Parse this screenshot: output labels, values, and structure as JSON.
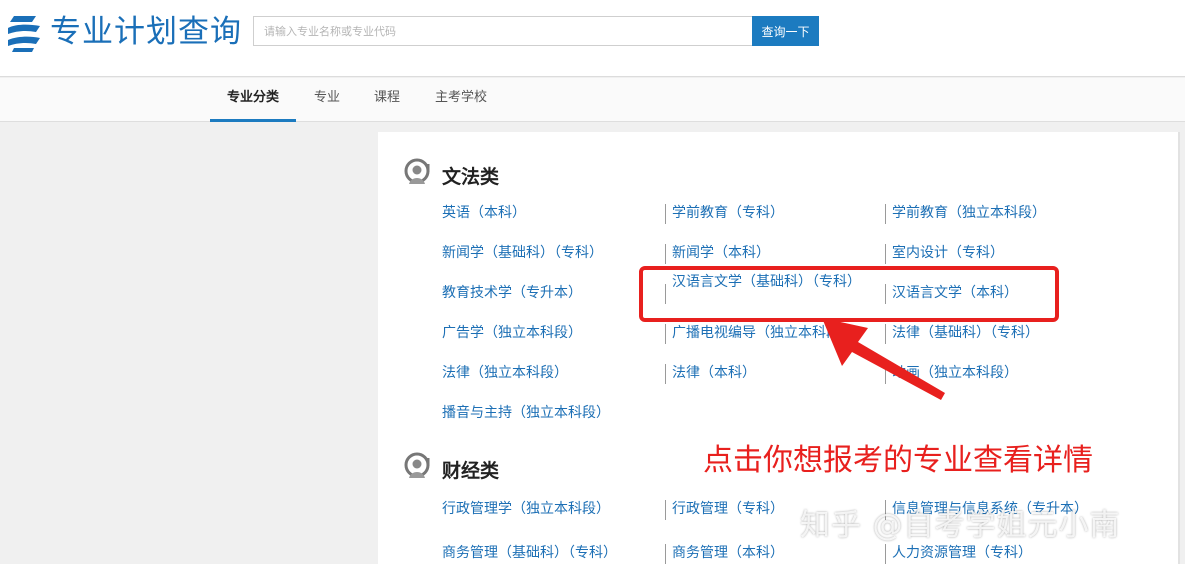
{
  "header": {
    "site_title": "专业计划查询",
    "search_placeholder": "请输入专业名称或专业代码",
    "search_button": "查询一下"
  },
  "nav": {
    "tabs": [
      "专业分类",
      "专业",
      "课程",
      "主考学校"
    ],
    "active": "专业分类"
  },
  "categories": [
    {
      "title": "文法类",
      "icon": "at-sign-person-icon",
      "rows": [
        [
          "英语（本科）",
          "学前教育（专科）",
          "学前教育（独立本科段）"
        ],
        [
          "新闻学（基础科）（专科）",
          "新闻学（本科）",
          "室内设计（专科）"
        ],
        [
          "教育技术学（专升本）",
          "汉语言文学（基础科）（专科）",
          "汉语言文学（本科）"
        ],
        [
          "广告学（独立本科段）",
          "广播电视编导（独立本科段）",
          "法律（基础科）（专科）"
        ],
        [
          "法律（独立本科段）",
          "法律（本科）",
          "动画（独立本科段）"
        ],
        [
          "播音与主持（独立本科段）"
        ]
      ]
    },
    {
      "title": "财经类",
      "icon": "at-sign-person-icon",
      "rows": [
        [
          "行政管理学（独立本科段）",
          "行政管理（专科）",
          "信息管理与信息系统（专升本）"
        ],
        [
          "商务管理（基础科）（专科）",
          "商务管理（本科）",
          "人力资源管理（专科）"
        ]
      ]
    }
  ],
  "annotation": {
    "note": "点击你想报考的专业查看详情",
    "watermark": "知乎 @自考学姐元小南",
    "color": "#e8201e"
  },
  "colors": {
    "brand": "#1a6fb8",
    "link": "#1c6fb5",
    "button": "#1c7bc0"
  }
}
